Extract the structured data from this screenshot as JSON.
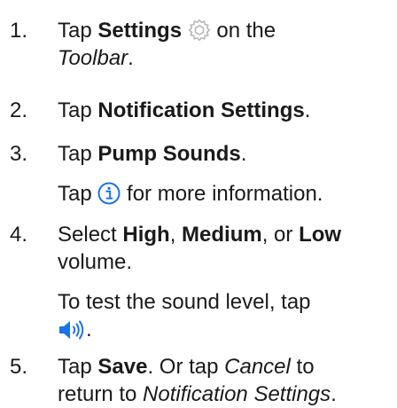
{
  "steps": [
    {
      "number": "1.",
      "text": {
        "a": "Tap ",
        "b_settings": "Settings",
        "c": " on the",
        "d_toolbar": "Toolbar",
        "e": "."
      },
      "icon": "gear-icon"
    },
    {
      "number": "2.",
      "text": {
        "a": "Tap ",
        "b_bold": "Notification Settings",
        "c": "."
      }
    },
    {
      "number": "3.",
      "text": {
        "a": "Tap ",
        "b_bold": "Pump Sounds",
        "c": ".",
        "sub_a": "Tap",
        "sub_b": " for more information."
      },
      "icon": "info-icon"
    },
    {
      "number": "4.",
      "text": {
        "a": "Select ",
        "b_high": "High",
        "c": ", ",
        "d_medium": "Medium",
        "e": ", or ",
        "f_low": "Low",
        "g": "volume.",
        "sub_a": "To test the sound level, tap",
        "sub_b": "."
      },
      "icon": "speaker-icon"
    },
    {
      "number": "5.",
      "text": {
        "a": "Tap ",
        "b_save": "Save",
        "c": ". Or tap ",
        "d_cancel": "Cancel",
        "e": " to",
        "f": "return to ",
        "g_notif": "Notification Settings",
        "h": "."
      }
    }
  ],
  "colors": {
    "text": "#1a1a1a",
    "gear_icon": "#b8b8b8",
    "accent_icon": "#1a73e8"
  }
}
